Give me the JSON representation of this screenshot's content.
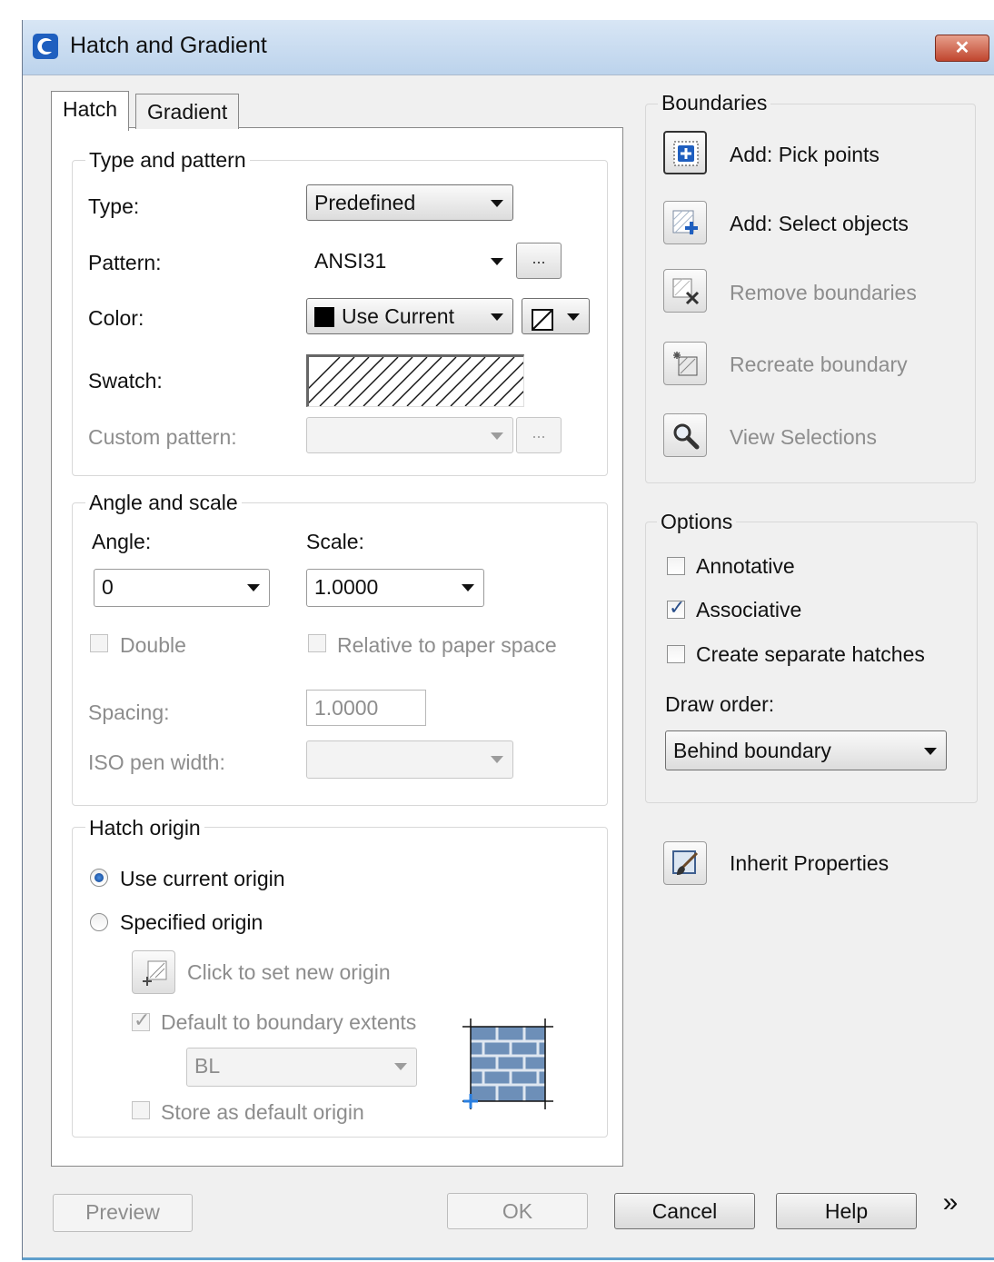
{
  "window": {
    "title": "Hatch and Gradient",
    "close_symbol": "✕"
  },
  "tabs": {
    "hatch": "Hatch",
    "gradient": "Gradient"
  },
  "type_pattern": {
    "title": "Type and pattern",
    "type_label": "Type:",
    "type_value": "Predefined",
    "pattern_label": "Pattern:",
    "pattern_value": "ANSI31",
    "pattern_browse": "...",
    "color_label": "Color:",
    "color_value": "Use Current",
    "swatch_label": "Swatch:",
    "custom_label": "Custom pattern:",
    "custom_value": "",
    "custom_browse": "..."
  },
  "angle_scale": {
    "title": "Angle and scale",
    "angle_label": "Angle:",
    "angle_value": "0",
    "scale_label": "Scale:",
    "scale_value": "1.0000",
    "double_label": "Double",
    "double_checked": false,
    "relative_label": "Relative to paper space",
    "relative_checked": false,
    "spacing_label": "Spacing:",
    "spacing_value": "1.0000",
    "iso_label": "ISO pen width:",
    "iso_value": ""
  },
  "hatch_origin": {
    "title": "Hatch origin",
    "use_current_label": "Use current origin",
    "use_current_selected": true,
    "specified_label": "Specified origin",
    "specified_selected": false,
    "click_set_label": "Click to set new origin",
    "default_extents_label": "Default to boundary extents",
    "default_extents_checked": true,
    "position_value": "BL",
    "store_default_label": "Store as default origin",
    "store_default_checked": false
  },
  "boundaries": {
    "title": "Boundaries",
    "pick_points": "Add: Pick points",
    "select_objects": "Add: Select objects",
    "remove": "Remove boundaries",
    "recreate": "Recreate boundary",
    "view": "View Selections"
  },
  "options": {
    "title": "Options",
    "annotative_label": "Annotative",
    "annotative_checked": false,
    "associative_label": "Associative",
    "associative_checked": true,
    "separate_label": "Create separate hatches",
    "separate_checked": false,
    "draw_order_label": "Draw order:",
    "draw_order_value": "Behind boundary"
  },
  "inherit": {
    "label": "Inherit Properties"
  },
  "footer": {
    "preview": "Preview",
    "ok": "OK",
    "cancel": "Cancel",
    "help": "Help",
    "more": "»"
  },
  "icons": [
    "app-logo-icon",
    "close-icon",
    "pick-points-icon",
    "select-objects-icon",
    "remove-boundaries-icon",
    "recreate-boundary-icon",
    "view-selections-icon",
    "inherit-properties-icon",
    "set-origin-icon",
    "origin-preview-icon",
    "color-swatch-icon",
    "transparency-icon"
  ],
  "colors": {
    "title_bar": "#bcd3ec",
    "accent": "#1f5fbf",
    "close": "#c0452e",
    "brick": "#6d8fb8"
  }
}
